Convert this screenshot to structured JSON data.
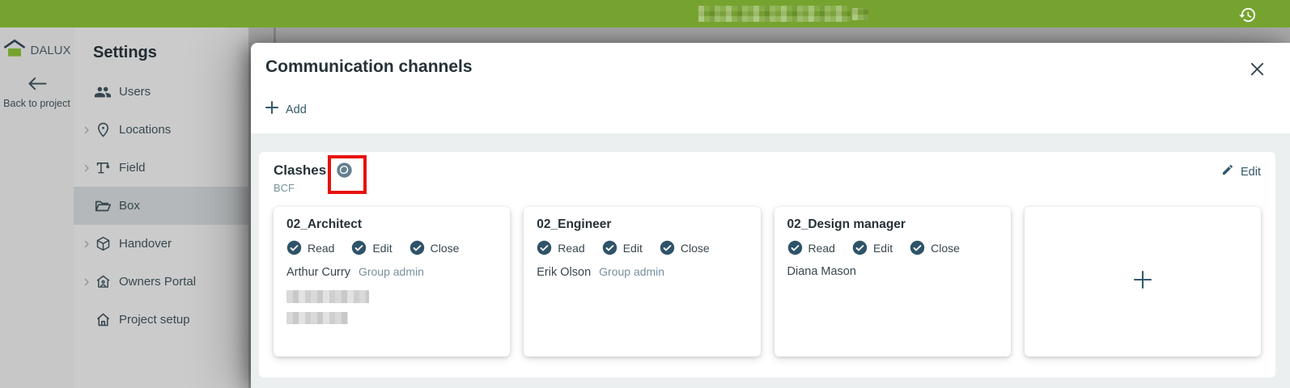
{
  "colors": {
    "brand_green": "#76A32F",
    "slate_text": "#37474F",
    "accent_blue": "#33596B",
    "muted_blue": "#78909C",
    "annotation_red": "#E8100C",
    "check_circle": "#2E5368"
  },
  "topbar": {
    "history_icon": "history-icon"
  },
  "sidebar": {
    "logo_text": "DALUX",
    "back_label": "Back to project",
    "title": "Settings",
    "items": [
      {
        "label": "Users",
        "icon": "users-icon",
        "expandable": false,
        "selected": false
      },
      {
        "label": "Locations",
        "icon": "location-pin-icon",
        "expandable": true,
        "selected": false
      },
      {
        "label": "Field",
        "icon": "crane-icon",
        "expandable": true,
        "selected": false
      },
      {
        "label": "Box",
        "icon": "open-folder-icon",
        "expandable": false,
        "selected": true
      },
      {
        "label": "Handover",
        "icon": "cube-icon",
        "expandable": true,
        "selected": false
      },
      {
        "label": "Owners Portal",
        "icon": "house-person-icon",
        "expandable": true,
        "selected": false
      },
      {
        "label": "Project setup",
        "icon": "house-icon",
        "expandable": false,
        "selected": false
      }
    ]
  },
  "modal": {
    "title": "Communication channels",
    "add_label": "Add",
    "close_icon": "close-icon",
    "section": {
      "title": "Clashes",
      "type_label": "BCF",
      "edit_label": "Edit",
      "title_icon": "sphere-model-icon",
      "annotation": "red-highlight-box"
    },
    "cards": [
      {
        "title": "02_Architect",
        "permissions": [
          "Read",
          "Edit",
          "Close"
        ],
        "member_name": "Arthur Curry",
        "member_role": "Group admin",
        "redacted_lines": 2
      },
      {
        "title": "02_Engineer",
        "permissions": [
          "Read",
          "Edit",
          "Close"
        ],
        "member_name": "Erik Olson",
        "member_role": "Group admin",
        "redacted_lines": 0
      },
      {
        "title": "02_Design manager",
        "permissions": [
          "Read",
          "Edit",
          "Close"
        ],
        "member_name": "Diana Mason",
        "member_role": "",
        "redacted_lines": 0
      },
      {
        "add_symbol": "+"
      }
    ]
  }
}
